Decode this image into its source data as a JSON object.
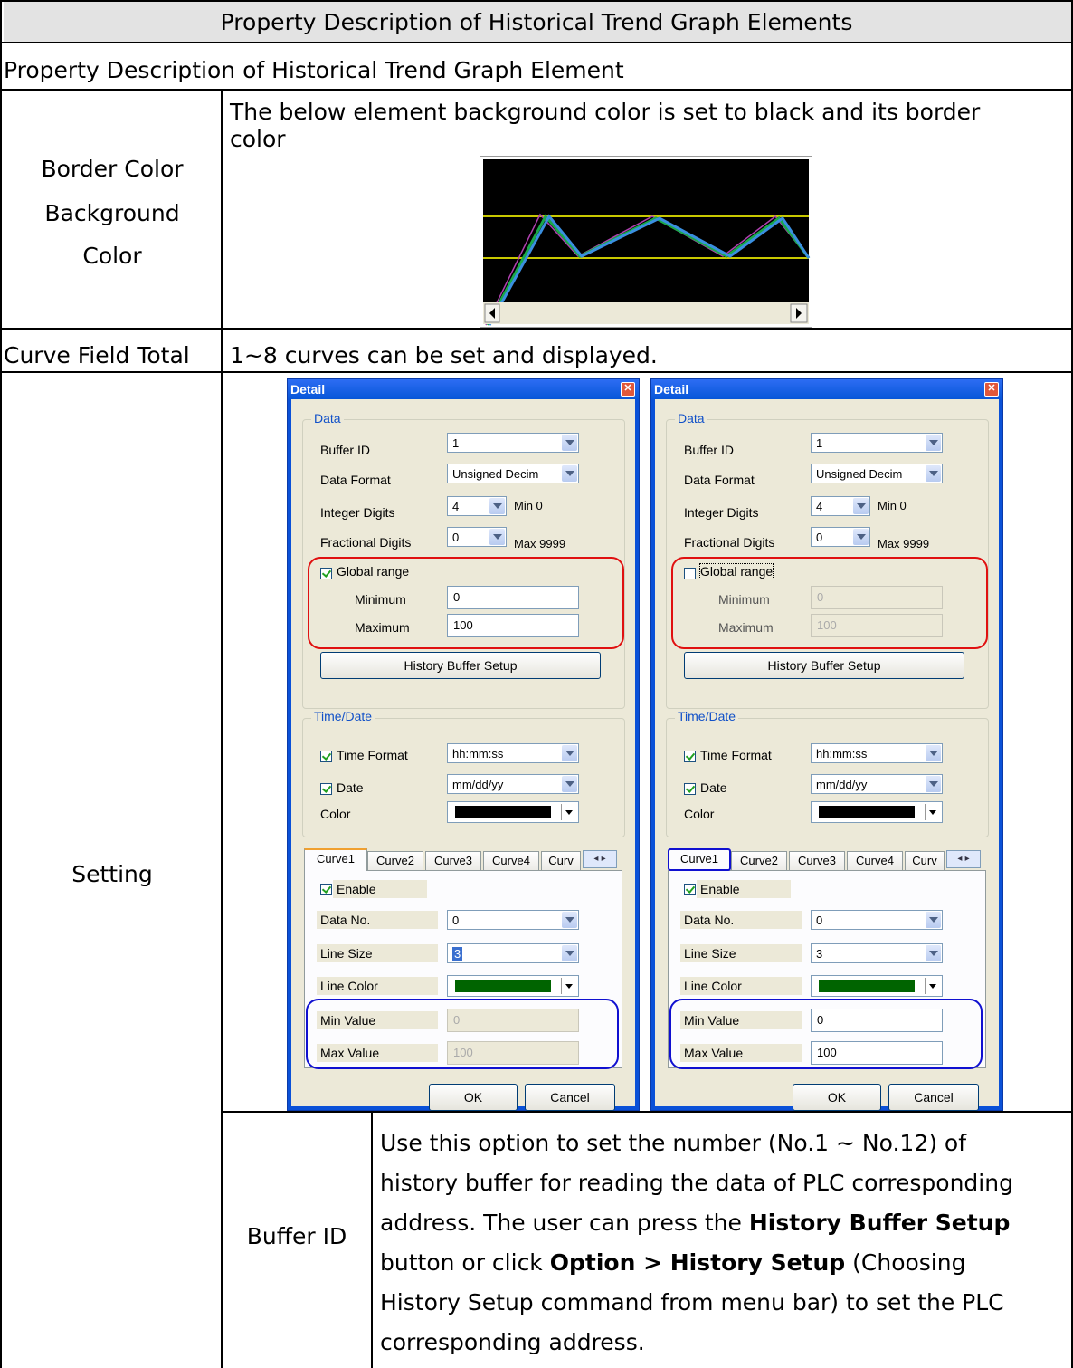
{
  "table": {
    "title": "Property Description of Historical Trend Graph Elements",
    "subtitle": "Property Description of Historical Trend Graph Element",
    "rows": {
      "border": {
        "label_lines": [
          "Border Color",
          "Background",
          "Color"
        ],
        "desc_line1": "The below element background color is set to black and its border",
        "desc_line2": "color"
      },
      "curve": {
        "label": "Curve Field Total",
        "desc": "1~8 curves can be set and displayed."
      },
      "setting": {
        "label": "Setting"
      },
      "buffer": {
        "label": "Buffer ID",
        "desc": {
          "l1": "Use this option to set the number (No.1 ~ No.12) of",
          "l2": "history buffer for reading the data of PLC corresponding",
          "l3a": "address. The user can press the ",
          "l3b": "History Buffer Setup",
          "l4a": "button or click ",
          "l4b": "Option",
          "l4c": " > ",
          "l4d": "History Setup",
          "l4e": " (Choosing",
          "l5": "History Setup command from menu bar) to set the PLC",
          "l6": "corresponding address."
        }
      }
    }
  },
  "dialog": {
    "title": "Detail",
    "close_glyph": "✕",
    "data_legend": "Data",
    "buffer_id_label": "Buffer ID",
    "buffer_id_value": "1",
    "data_format_label": "Data Format",
    "data_format_value": "Unsigned Decim",
    "integer_digits_label": "Integer Digits",
    "integer_digits_value": "4",
    "min_note": "Min 0",
    "fractional_digits_label": "Fractional Digits",
    "fractional_digits_value": "0",
    "max_note": "Max 9999",
    "global_range_label": "Global range",
    "minimum_label": "Minimum",
    "maximum_label": "Maximum",
    "minimum_value": "0",
    "maximum_value": "100",
    "history_button": "History Buffer Setup",
    "time_legend": "Time/Date",
    "time_format_label": "Time Format",
    "time_format_value": "hh:mm:ss",
    "date_label": "Date",
    "date_value": "mm/dd/yy",
    "color_label": "Color",
    "tabs": [
      "Curve1",
      "Curve2",
      "Curve3",
      "Curve4",
      "Curv"
    ],
    "tab_nav": "◂ ▸",
    "enable_label": "Enable",
    "data_no_label": "Data No.",
    "data_no_value": "0",
    "line_size_label": "Line Size",
    "line_size_value": "3",
    "line_color_label": "Line Color",
    "min_value_label": "Min Value",
    "max_value_label": "Max Value",
    "min_value": "0",
    "max_value": "100",
    "ok": "OK",
    "cancel": "Cancel"
  },
  "dialogs_state": [
    {
      "global_range_checked": true,
      "curve_range_enabled": false,
      "line_size_highlighted": true
    },
    {
      "global_range_checked": false,
      "curve_range_enabled": true,
      "line_size_highlighted": false
    }
  ],
  "colors": {
    "graph_background": "#000000",
    "graph_reference_lines": "#c8c800",
    "line_color_swatch": "#006400",
    "global_range_ring": "#e01010",
    "curve_range_ring": "#1010d0"
  }
}
